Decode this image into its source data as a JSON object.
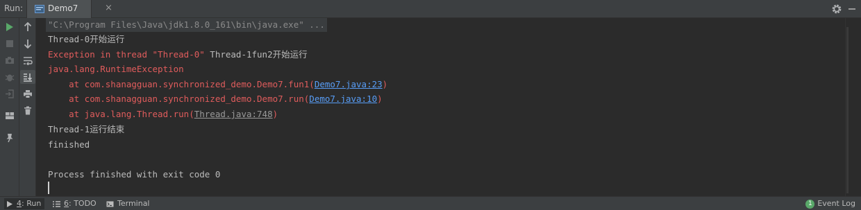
{
  "header": {
    "run_label": "Run:",
    "tab": {
      "label": "Demo7",
      "close": "×"
    }
  },
  "toolbar": {
    "buttons": [
      "run-icon",
      "arrow-up-icon",
      "stop-icon",
      "arrow-down-icon",
      "camera-icon",
      "soft-wrap-icon",
      "debug-icon",
      "scroll-to-end-icon",
      "login-icon",
      "print-icon",
      "layout-icon",
      "trash-icon",
      "pin-icon"
    ]
  },
  "console": {
    "cmd": "\"C:\\Program Files\\Java\\jdk1.8.0_161\\bin\\java.exe\" ...",
    "line1": "Thread-0开始运行",
    "line2_err": "Exception in thread \"Thread-0\" ",
    "line2_out": "Thread-1fun2开始运行",
    "line3": "java.lang.RuntimeException",
    "trace": [
      {
        "prefix": "    at com.shanagguan.synchronized_demo.Demo7.fun1(",
        "link": "Demo7.java:23",
        "suffix": ")"
      },
      {
        "prefix": "    at com.shanagguan.synchronized_demo.Demo7.run(",
        "link": "Demo7.java:10",
        "suffix": ")"
      },
      {
        "prefix": "    at java.lang.Thread.run(",
        "link": "Thread.java:748",
        "suffix": ")"
      }
    ],
    "line7": "Thread-1运行结束",
    "line8": "finished",
    "line10": "Process finished with exit code 0"
  },
  "statusbar": {
    "run": {
      "num": "4",
      "rest": ": Run"
    },
    "todo": {
      "num": "6",
      "rest": ": TODO"
    },
    "terminal": "Terminal",
    "event_count": "1",
    "event_log": "Event Log"
  },
  "colors": {
    "background": "#2b2b2b",
    "panel": "#3c3f41",
    "error": "#e05c5c",
    "link": "#589df6",
    "run_green": "#59a869"
  }
}
